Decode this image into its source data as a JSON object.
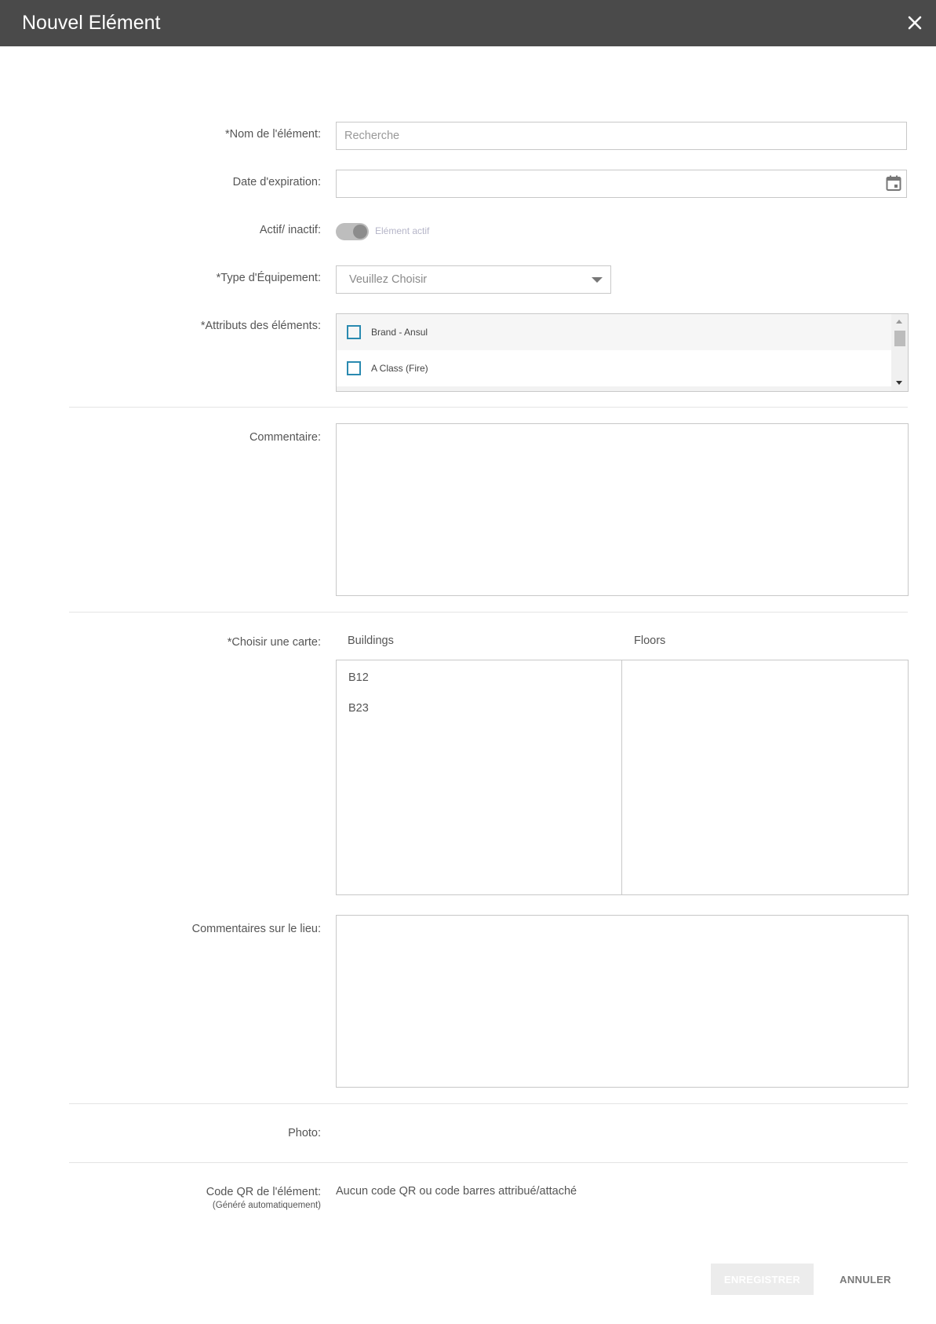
{
  "dialog": {
    "title": "Nouvel Elément",
    "close_icon": "close-icon"
  },
  "form": {
    "name": {
      "label": "*Nom de l'élément:",
      "placeholder": "Recherche",
      "value": ""
    },
    "expiration": {
      "label": "Date d'expiration:",
      "value": "",
      "icon": "calendar-icon"
    },
    "active": {
      "label": "Actif/ inactif:",
      "toggle_text": "Elément actif",
      "state": "on (disabled)"
    },
    "equipment_type": {
      "label": "*Type d'Équipement:",
      "selected": "Veuillez Choisir"
    },
    "attributes": {
      "label": "*Attributs des éléments:",
      "items": [
        {
          "label": "Brand - Ansul",
          "checked": false
        },
        {
          "label": "A Class (Fire)",
          "checked": false
        }
      ]
    },
    "comment": {
      "label": "Commentaire:",
      "value": ""
    },
    "map": {
      "label": "*Choisir une carte:",
      "buildings_header": "Buildings",
      "floors_header": "Floors",
      "buildings": [
        "B12",
        "B23"
      ],
      "floors": []
    },
    "location_comment": {
      "label": "Commentaires sur le lieu:",
      "value": ""
    },
    "photo": {
      "label": "Photo:"
    },
    "qr": {
      "label": "Code QR de l'élément:",
      "sublabel": "(Généré automatiquement)",
      "value": "Aucun code QR ou code barres attribué/attaché"
    }
  },
  "actions": {
    "save_label": "ENREGISTRER",
    "cancel_label": "ANNULER"
  },
  "colors": {
    "titlebar": "#4a4a4a",
    "checkbox_border": "#2a8ab0",
    "save_disabled_bg": "#ececec"
  }
}
